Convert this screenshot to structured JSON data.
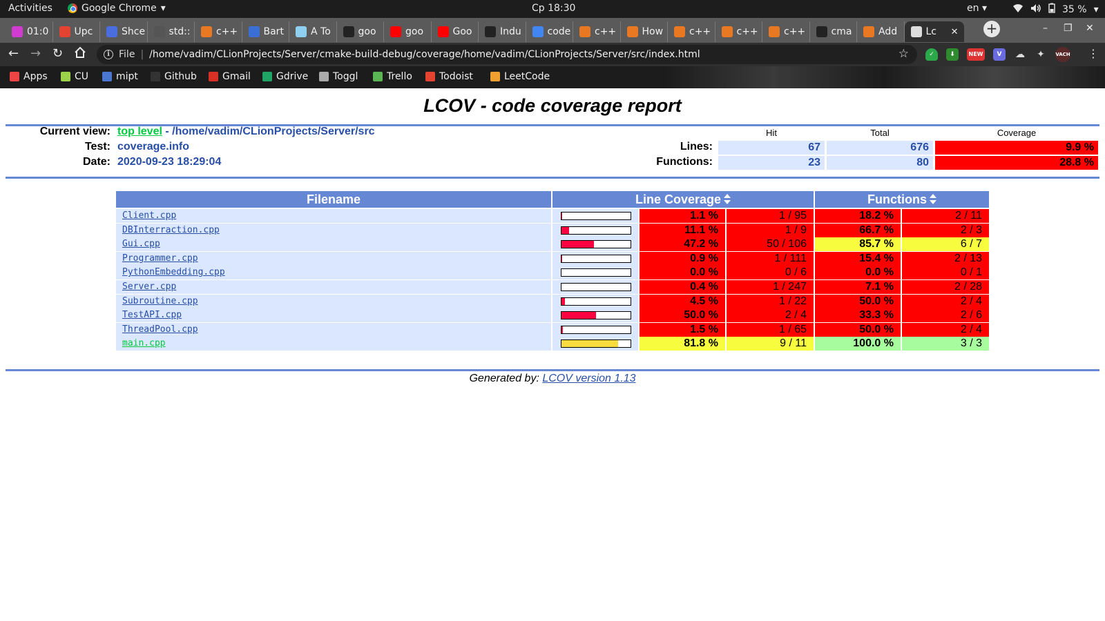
{
  "system_bar": {
    "activities": "Activities",
    "app_name": "Google Chrome",
    "clock": "Ср 18:30",
    "language": "en",
    "battery": "35 %"
  },
  "tabs": [
    {
      "label": "01:0",
      "icon": "pomodoro-icon",
      "color": "#d23bd2"
    },
    {
      "label": "Upc",
      "icon": "todoist-icon",
      "color": "#e44332"
    },
    {
      "label": "Shce",
      "icon": "docs-icon",
      "color": "#4a6ee0"
    },
    {
      "label": "std::",
      "icon": "cppreference-icon",
      "color": "#555555"
    },
    {
      "label": "c++",
      "icon": "stackoverflow-icon",
      "color": "#e87922"
    },
    {
      "label": "Bart",
      "icon": "bf-icon",
      "color": "#3b6fd6"
    },
    {
      "label": "A To",
      "icon": "doc-icon",
      "color": "#8fd0f0"
    },
    {
      "label": "goo",
      "icon": "github-icon",
      "color": "#222222"
    },
    {
      "label": "goo",
      "icon": "youtube-icon",
      "color": "#ff0000"
    },
    {
      "label": "Goo",
      "icon": "youtube-icon",
      "color": "#ff0000"
    },
    {
      "label": "Indu",
      "icon": "github-icon",
      "color": "#222222"
    },
    {
      "label": "code",
      "icon": "google-icon",
      "color": "#4285f4"
    },
    {
      "label": "c++",
      "icon": "stackoverflow-icon",
      "color": "#e87922"
    },
    {
      "label": "How",
      "icon": "stackoverflow-icon",
      "color": "#e87922"
    },
    {
      "label": "c++",
      "icon": "stackoverflow-icon",
      "color": "#e87922"
    },
    {
      "label": "c++",
      "icon": "stackoverflow-icon",
      "color": "#e87922"
    },
    {
      "label": "c++",
      "icon": "stackoverflow-icon",
      "color": "#e87922"
    },
    {
      "label": "cma",
      "icon": "github-icon",
      "color": "#222222"
    },
    {
      "label": "Add",
      "icon": "stackoverflow-icon",
      "color": "#e87922"
    },
    {
      "label": "Lc",
      "icon": "globe-icon",
      "color": "#dddddd",
      "active": true
    }
  ],
  "toolbar": {
    "scheme": "File",
    "url": "/home/vadim/CLionProjects/Server/cmake-build-debug/coverage/home/vadim/CLionProjects/Server/src/index.html",
    "ext_badge": "NEW",
    "avatar_text": "VACH"
  },
  "bookmarks": [
    {
      "label": "Apps",
      "icon": "apps-grid-icon",
      "color": "#e44"
    },
    {
      "label": "CU",
      "icon": "cu-icon",
      "color": "#9bd34a"
    },
    {
      "label": "mipt",
      "icon": "mipt-icon",
      "color": "#4a78d0"
    },
    {
      "label": "Github",
      "icon": "github-icon",
      "color": "#333333"
    },
    {
      "label": "Gmail",
      "icon": "gmail-icon",
      "color": "#d93025"
    },
    {
      "label": "Gdrive",
      "icon": "gdrive-icon",
      "color": "#1fa463"
    },
    {
      "label": "Toggl",
      "icon": "toggl-icon",
      "color": "#aaaaaa"
    },
    {
      "label": "Trello",
      "icon": "trello-icon",
      "color": "#5ab552"
    },
    {
      "label": "Todoist",
      "icon": "todoist-icon",
      "color": "#e44332"
    },
    {
      "label": "LeetCode",
      "icon": "leetcode-icon",
      "color": "#f0a030"
    }
  ],
  "report": {
    "title": "LCOV - code coverage report",
    "current_view_label": "Current view:",
    "top_level": "top level",
    "path": " - /home/vadim/CLionProjects/Server/src",
    "test_label": "Test:",
    "test_value": "coverage.info",
    "date_label": "Date:",
    "date_value": "2020-09-23 18:29:04",
    "col_hit": "Hit",
    "col_total": "Total",
    "col_coverage": "Coverage",
    "lines_label": "Lines:",
    "lines_hit": "67",
    "lines_total": "676",
    "lines_coverage": "9.9 %",
    "functions_label": "Functions:",
    "functions_hit": "23",
    "functions_total": "80",
    "functions_coverage": "28.8 %",
    "th_filename": "Filename",
    "th_line_coverage": "Line Coverage",
    "th_functions": "Functions",
    "colors": {
      "low": "#ff0000",
      "med": "#f8fc3f",
      "high": "#a7fc9d",
      "bar_low": "#ff0040",
      "bar_med": "#f8dc3f"
    },
    "files": [
      {
        "name": "Client.cpp",
        "line_pct": "1.1 %",
        "line_frac": 0.011,
        "lines": "1 / 95",
        "func_pct": "18.2 %",
        "funcs": "2 / 11",
        "line_level": "low",
        "func_level": "low"
      },
      {
        "name": "DBInterraction.cpp",
        "line_pct": "11.1 %",
        "line_frac": 0.111,
        "lines": "1 / 9",
        "func_pct": "66.7 %",
        "funcs": "2 / 3",
        "line_level": "low",
        "func_level": "low"
      },
      {
        "name": "Gui.cpp",
        "line_pct": "47.2 %",
        "line_frac": 0.472,
        "lines": "50 / 106",
        "func_pct": "85.7 %",
        "funcs": "6 / 7",
        "line_level": "low",
        "func_level": "med"
      },
      {
        "name": "Programmer.cpp",
        "line_pct": "0.9 %",
        "line_frac": 0.009,
        "lines": "1 / 111",
        "func_pct": "15.4 %",
        "funcs": "2 / 13",
        "line_level": "low",
        "func_level": "low"
      },
      {
        "name": "PythonEmbedding.cpp",
        "line_pct": "0.0 %",
        "line_frac": 0.0,
        "lines": "0 / 6",
        "func_pct": "0.0 %",
        "funcs": "0 / 1",
        "line_level": "low",
        "func_level": "low"
      },
      {
        "name": "Server.cpp",
        "line_pct": "0.4 %",
        "line_frac": 0.004,
        "lines": "1 / 247",
        "func_pct": "7.1 %",
        "funcs": "2 / 28",
        "line_level": "low",
        "func_level": "low"
      },
      {
        "name": "Subroutine.cpp",
        "line_pct": "4.5 %",
        "line_frac": 0.045,
        "lines": "1 / 22",
        "func_pct": "50.0 %",
        "funcs": "2 / 4",
        "line_level": "low",
        "func_level": "low"
      },
      {
        "name": "TestAPI.cpp",
        "line_pct": "50.0 %",
        "line_frac": 0.5,
        "lines": "2 / 4",
        "func_pct": "33.3 %",
        "funcs": "2 / 6",
        "line_level": "low",
        "func_level": "low"
      },
      {
        "name": "ThreadPool.cpp",
        "line_pct": "1.5 %",
        "line_frac": 0.015,
        "lines": "1 / 65",
        "func_pct": "50.0 %",
        "funcs": "2 / 4",
        "line_level": "low",
        "func_level": "low"
      },
      {
        "name": "main.cpp",
        "line_pct": "81.8 %",
        "line_frac": 0.818,
        "lines": "9 / 11",
        "func_pct": "100.0 %",
        "funcs": "3 / 3",
        "line_level": "med",
        "func_level": "high"
      }
    ],
    "footer_prefix": "Generated by: ",
    "footer_link": "LCOV version 1.13"
  }
}
